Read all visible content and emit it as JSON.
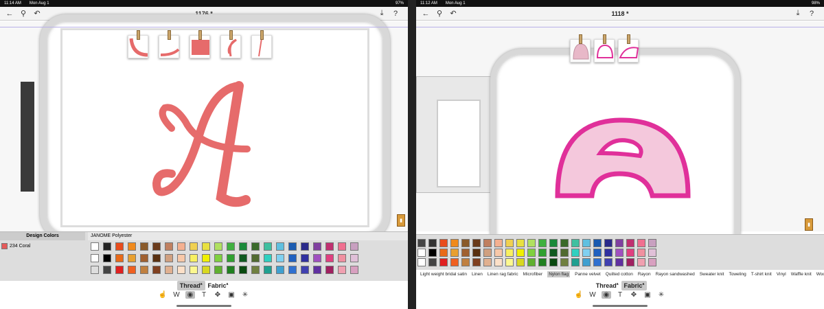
{
  "left": {
    "status": {
      "time": "11:14 AM",
      "date": "Mon Aug 1",
      "battery": "97%"
    },
    "title": "1176 *",
    "design_colors_header": "Design Colors",
    "design_color": {
      "code": "234 Coral",
      "hex": "#e55a5a"
    },
    "brand": "JANOME Polyester",
    "tabs": {
      "thread": "Thread",
      "fabric": "Fabric"
    },
    "letter_color": "#e66b6b"
  },
  "right": {
    "status": {
      "time": "11:12 AM",
      "date": "Mon Aug 1",
      "battery": "98%"
    },
    "title": "1118 *",
    "fabrics": [
      "Light weight bridal satin",
      "Linen",
      "Linen rag fabric",
      "Microfiber",
      "Nylon flag",
      "Panne velvet",
      "Quilted cotton",
      "Rayon",
      "Rayon sandwashed",
      "Sweater knit",
      "Toweling",
      "T-shirt knit",
      "Vinyl",
      "Waffle knit",
      "Wool"
    ],
    "active_fabric": "Nylon flag",
    "tabs": {
      "thread": "Thread",
      "fabric": "Fabric"
    },
    "letter_color": "#e0309a"
  },
  "palette_colors": [
    [
      "#ffffff",
      "#222222",
      "#e84c1c",
      "#f08a1c",
      "#8a5a2a",
      "#6a3a1a",
      "#c08060",
      "#f4b090",
      "#f0d050",
      "#e8e040",
      "#b0e060",
      "#40b040",
      "#1a8a3a",
      "#3a6a2a",
      "#40c0a0",
      "#60c0e0",
      "#1a5ab0",
      "#2a2a8a",
      "#8040a0",
      "#c03070",
      "#f07090",
      "#c8a0c0"
    ],
    [
      "#ffffff",
      "#000000",
      "#e86a1a",
      "#e8a030",
      "#a06030",
      "#5a3010",
      "#d0a080",
      "#f8c8a8",
      "#f8f060",
      "#f0f000",
      "#80d040",
      "#30a030",
      "#105a20",
      "#506a30",
      "#30d0c0",
      "#80d0f0",
      "#2060c0",
      "#3030a0",
      "#a050c0",
      "#e04080",
      "#f090a0",
      "#e0c0d8"
    ],
    [
      "#dddddd",
      "#444444",
      "#e02020",
      "#f06020",
      "#c08040",
      "#804020",
      "#e0b090",
      "#fce0c8",
      "#fcf890",
      "#d8d820",
      "#60b030",
      "#208020",
      "#0a4a10",
      "#708040",
      "#20a090",
      "#40a0d0",
      "#3070d0",
      "#4040b0",
      "#6030a0",
      "#a02060",
      "#f0a0b0",
      "#d8a0c0"
    ]
  ],
  "pink_palette_colors": [
    [
      "#444444",
      "#333333",
      "#e84c1c",
      "#f08a1c",
      "#8a5a2a",
      "#6a3a1a",
      "#c08060",
      "#f4b090",
      "#f0d050",
      "#e8e040",
      "#b0e060",
      "#40b040",
      "#1a8a3a",
      "#3a6a2a",
      "#40c0a0",
      "#60c0e0",
      "#1a5ab0",
      "#2a2a8a",
      "#8040a0",
      "#c03070",
      "#f07090",
      "#c8a0c0"
    ],
    [
      "#ffffff",
      "#000000",
      "#e86a1a",
      "#e8a030",
      "#a06030",
      "#5a3010",
      "#d0a080",
      "#f8c8a8",
      "#f8f060",
      "#f0f000",
      "#80d040",
      "#30a030",
      "#105a20",
      "#506a30",
      "#30d0c0",
      "#80d0f0",
      "#2060c0",
      "#3030a0",
      "#a050c0",
      "#e04080",
      "#f090a0",
      "#e0c0d8"
    ],
    [
      "#ffffff",
      "#444444",
      "#e02020",
      "#f06020",
      "#c08040",
      "#804020",
      "#e0b090",
      "#fce0c8",
      "#fcf890",
      "#d8d820",
      "#60b030",
      "#208020",
      "#0a4a10",
      "#708040",
      "#20a090",
      "#40a0d0",
      "#3070d0",
      "#4040b0",
      "#6030a0",
      "#a02060",
      "#f0a0b0",
      "#d8a0c0"
    ]
  ],
  "icons": [
    "back-arrow-icon",
    "zoom-icon",
    "undo-icon",
    "download-icon",
    "help-icon",
    "select-hand-icon",
    "edit-icon",
    "hoop-icon",
    "text-icon",
    "move-icon",
    "frame-icon",
    "sparkle-icon"
  ]
}
